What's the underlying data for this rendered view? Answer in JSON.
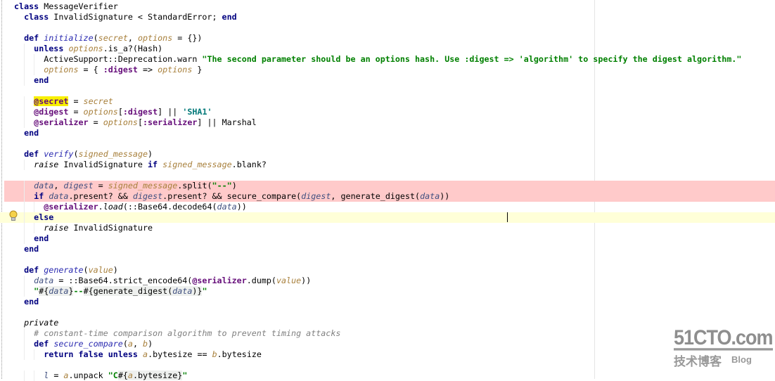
{
  "editor": {
    "lines": [
      {
        "indent": 0,
        "tokens": [
          [
            "class",
            "kw"
          ],
          [
            " MessageVerifier",
            ""
          ]
        ]
      },
      {
        "indent": 1,
        "tokens": [
          [
            "class",
            "kw"
          ],
          [
            " InvalidSignature < StandardError; ",
            ""
          ],
          [
            "end",
            "kw"
          ]
        ]
      },
      {
        "indent": 0,
        "tokens": []
      },
      {
        "indent": 1,
        "tokens": [
          [
            "def",
            "kw"
          ],
          [
            " ",
            ""
          ],
          [
            "initialize",
            "fn"
          ],
          [
            "(",
            ""
          ],
          [
            "secret",
            "param"
          ],
          [
            ", ",
            ""
          ],
          [
            "options",
            "param"
          ],
          [
            " = {})",
            ""
          ]
        ]
      },
      {
        "indent": 2,
        "tokens": [
          [
            "unless",
            "kw"
          ],
          [
            " ",
            ""
          ],
          [
            "options",
            "param"
          ],
          [
            ".is_a?(Hash)",
            ""
          ]
        ]
      },
      {
        "indent": 3,
        "tokens": [
          [
            "ActiveSupport::Deprecation.warn ",
            ""
          ],
          [
            "\"The second parameter should be an options hash. Use :digest => 'algorithm' to specify the digest algorithm.\"",
            "str"
          ]
        ]
      },
      {
        "indent": 3,
        "tokens": [
          [
            "options",
            "param"
          ],
          [
            " = { ",
            ""
          ],
          [
            ":digest",
            "sym"
          ],
          [
            " => ",
            ""
          ],
          [
            "options",
            "param"
          ],
          [
            " }",
            ""
          ]
        ]
      },
      {
        "indent": 2,
        "tokens": [
          [
            "end",
            "kw"
          ]
        ]
      },
      {
        "indent": 0,
        "tokens": []
      },
      {
        "indent": 2,
        "tokens": [
          [
            "@secret",
            "ivar hl"
          ],
          [
            " = ",
            ""
          ],
          [
            "secret",
            "param"
          ]
        ]
      },
      {
        "indent": 2,
        "tokens": [
          [
            "@digest",
            "ivar"
          ],
          [
            " = ",
            ""
          ],
          [
            "options",
            "param"
          ],
          [
            "[",
            ""
          ],
          [
            ":digest",
            "sym"
          ],
          [
            "] || ",
            ""
          ],
          [
            "'SHA1'",
            "sq"
          ]
        ]
      },
      {
        "indent": 2,
        "tokens": [
          [
            "@serializer",
            "ivar"
          ],
          [
            " = ",
            ""
          ],
          [
            "options",
            "param"
          ],
          [
            "[",
            ""
          ],
          [
            ":serializer",
            "sym"
          ],
          [
            "] || Marshal",
            ""
          ]
        ]
      },
      {
        "indent": 1,
        "tokens": [
          [
            "end",
            "kw"
          ]
        ]
      },
      {
        "indent": 0,
        "tokens": []
      },
      {
        "indent": 1,
        "tokens": [
          [
            "def",
            "kw"
          ],
          [
            " ",
            ""
          ],
          [
            "verify",
            "fn"
          ],
          [
            "(",
            ""
          ],
          [
            "signed_message",
            "param"
          ],
          [
            ")",
            ""
          ]
        ]
      },
      {
        "indent": 2,
        "tokens": [
          [
            "raise",
            "it"
          ],
          [
            " InvalidSignature ",
            ""
          ],
          [
            "if",
            "kw"
          ],
          [
            " ",
            ""
          ],
          [
            "signed_message",
            "param"
          ],
          [
            ".blank?",
            ""
          ]
        ]
      },
      {
        "indent": 0,
        "tokens": []
      },
      {
        "indent": 2,
        "state": "error",
        "tokens": [
          [
            "data",
            "local"
          ],
          [
            ", ",
            ""
          ],
          [
            "digest",
            "local"
          ],
          [
            " = ",
            ""
          ],
          [
            "signed_message",
            "param"
          ],
          [
            ".split(",
            ""
          ],
          [
            "\"--\"",
            "str"
          ],
          [
            ")",
            ""
          ]
        ]
      },
      {
        "indent": 2,
        "state": "error",
        "tokens": [
          [
            "if",
            "kw"
          ],
          [
            " ",
            ""
          ],
          [
            "data",
            "local"
          ],
          [
            ".present? && ",
            ""
          ],
          [
            "digest",
            "local"
          ],
          [
            ".present? && secure_compare(",
            ""
          ],
          [
            "digest",
            "local"
          ],
          [
            ", generate_digest(",
            ""
          ],
          [
            "data",
            "local"
          ],
          [
            "))",
            ""
          ]
        ]
      },
      {
        "indent": 3,
        "tokens": [
          [
            "@serializer",
            "ivar"
          ],
          [
            ".",
            ""
          ],
          [
            "load",
            "it"
          ],
          [
            "(::Base64.decode64(",
            ""
          ],
          [
            "data",
            "local"
          ],
          [
            "))",
            ""
          ]
        ]
      },
      {
        "indent": 2,
        "state": "current",
        "tokens": [
          [
            "else",
            "kw"
          ]
        ]
      },
      {
        "indent": 3,
        "tokens": [
          [
            "raise",
            "it"
          ],
          [
            " InvalidSignature",
            ""
          ]
        ]
      },
      {
        "indent": 2,
        "tokens": [
          [
            "end",
            "kw"
          ]
        ]
      },
      {
        "indent": 1,
        "tokens": [
          [
            "end",
            "kw"
          ]
        ]
      },
      {
        "indent": 0,
        "tokens": []
      },
      {
        "indent": 1,
        "tokens": [
          [
            "def",
            "kw"
          ],
          [
            " ",
            ""
          ],
          [
            "generate",
            "fn"
          ],
          [
            "(",
            ""
          ],
          [
            "value",
            "param"
          ],
          [
            ")",
            ""
          ]
        ]
      },
      {
        "indent": 2,
        "tokens": [
          [
            "data",
            "local"
          ],
          [
            " = ::Base64.strict_encode64(",
            ""
          ],
          [
            "@serializer",
            "ivar"
          ],
          [
            ".dump(",
            ""
          ],
          [
            "value",
            "param"
          ],
          [
            "))",
            ""
          ]
        ]
      },
      {
        "indent": 2,
        "tokens": [
          [
            "\"",
            "str"
          ],
          [
            "#{",
            "interp"
          ],
          [
            "data",
            "local interp"
          ],
          [
            "}",
            "interp"
          ],
          [
            "--",
            "str"
          ],
          [
            "#{",
            "interp"
          ],
          [
            "generate_digest(",
            "interp"
          ],
          [
            "data",
            "local interp"
          ],
          [
            ")}",
            "interp"
          ],
          [
            "\"",
            "str"
          ]
        ]
      },
      {
        "indent": 1,
        "tokens": [
          [
            "end",
            "kw"
          ]
        ]
      },
      {
        "indent": 0,
        "tokens": []
      },
      {
        "indent": 1,
        "tokens": [
          [
            "private",
            "it"
          ]
        ]
      },
      {
        "indent": 2,
        "tokens": [
          [
            "# constant-time comparison algorithm to prevent timing attacks",
            "cm"
          ]
        ]
      },
      {
        "indent": 2,
        "tokens": [
          [
            "def",
            "kw"
          ],
          [
            " ",
            ""
          ],
          [
            "secure_compare",
            "fn"
          ],
          [
            "(",
            ""
          ],
          [
            "a",
            "param"
          ],
          [
            ", ",
            ""
          ],
          [
            "b",
            "param"
          ],
          [
            ")",
            ""
          ]
        ]
      },
      {
        "indent": 3,
        "tokens": [
          [
            "return",
            "kw"
          ],
          [
            " ",
            ""
          ],
          [
            "false",
            "kw"
          ],
          [
            " ",
            ""
          ],
          [
            "unless",
            "kw"
          ],
          [
            " ",
            ""
          ],
          [
            "a",
            "param"
          ],
          [
            ".bytesize == ",
            ""
          ],
          [
            "b",
            "param"
          ],
          [
            ".bytesize",
            ""
          ]
        ]
      },
      {
        "indent": 0,
        "tokens": []
      },
      {
        "indent": 3,
        "tokens": [
          [
            "l",
            "local"
          ],
          [
            " = ",
            ""
          ],
          [
            "a",
            "param"
          ],
          [
            ".unpack ",
            ""
          ],
          [
            "\"C",
            "str"
          ],
          [
            "#{",
            "interp"
          ],
          [
            "a",
            "param interp"
          ],
          [
            ".bytesize}",
            "interp"
          ],
          [
            "\"",
            "str"
          ]
        ]
      }
    ],
    "intention_icon": "lightbulb-icon"
  },
  "watermark": {
    "main": "51CTO.com",
    "sub": "技术博客",
    "blog": "Blog"
  },
  "colors": {
    "error_line": "#ffcaca",
    "current_line": "#ffffd8",
    "keyword": "#000080",
    "string": "#008000",
    "ivar": "#660e7a"
  }
}
